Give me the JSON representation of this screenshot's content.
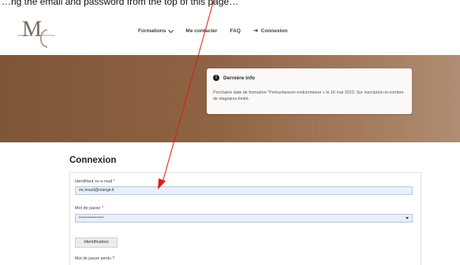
{
  "instruction": {
    "text": "…ng the email and password from the top of this page…"
  },
  "header": {
    "logo_letters": "MC",
    "logo_caption": "FORMATIONS · MC FORMATIONS",
    "nav": [
      {
        "label": "Formations",
        "has_dropdown": true
      },
      {
        "label": "Me contacter",
        "has_dropdown": false
      },
      {
        "label": "FAQ",
        "has_dropdown": false
      },
      {
        "label": "Connexion",
        "icon": "login-icon"
      }
    ]
  },
  "banner": {
    "info_title": "Dernière info",
    "info_text": "Prochaine date de formation \"Pemunlareum endummiene » le 16 mai 2023. Sur inscription et nombre de stagiaires limité."
  },
  "login": {
    "title": "Connexion",
    "username_label": "Identifiant ou e-mail",
    "username_value": "mc.lesud@orange.fr",
    "password_label": "Mot de passe",
    "password_value": "••••••••••••••",
    "submit_label": "Identification",
    "forgot_label": "Mot de passe perdu ?",
    "required_mark": "*"
  },
  "colors": {
    "banner": "#8e6343",
    "nav_text": "#4a3a2f",
    "input_fill": "#e8effc",
    "annotation_arrow": "#e01a1a",
    "required": "#d2232a"
  }
}
